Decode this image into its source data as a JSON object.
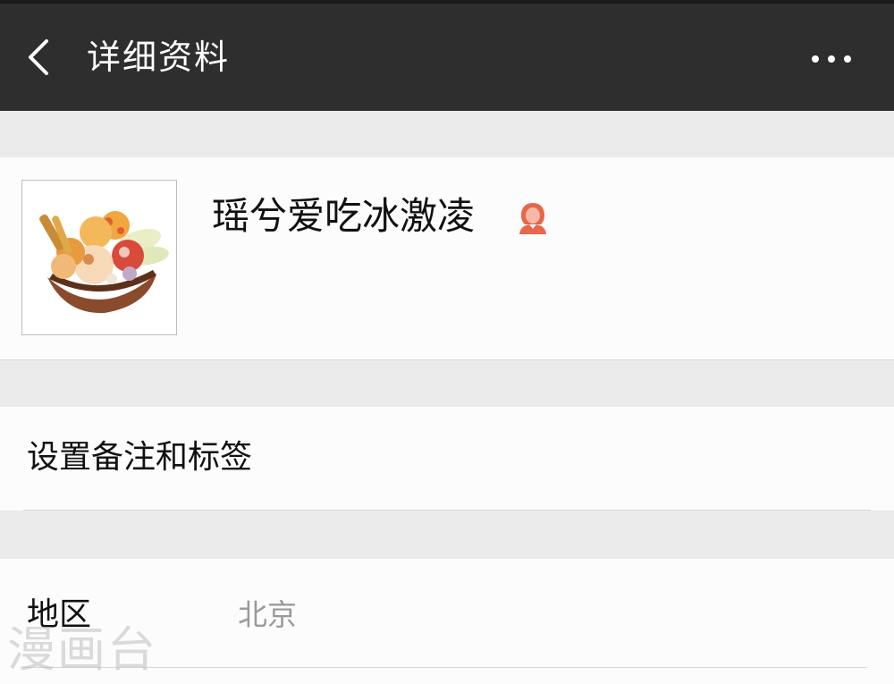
{
  "header": {
    "title": "详细资料",
    "back_icon": "chevron-left-icon",
    "more_icon": "more-dots-icon"
  },
  "profile": {
    "nickname": "瑶兮爱吃冰激凌",
    "avatar_icon": "ice-cream-basket-avatar",
    "gender_icon": "female-user-icon",
    "gender_color": "#e8664a"
  },
  "remark": {
    "label": "设置备注和标签"
  },
  "region": {
    "label": "地区",
    "value": "北京"
  },
  "watermark": {
    "text": "漫画台"
  }
}
